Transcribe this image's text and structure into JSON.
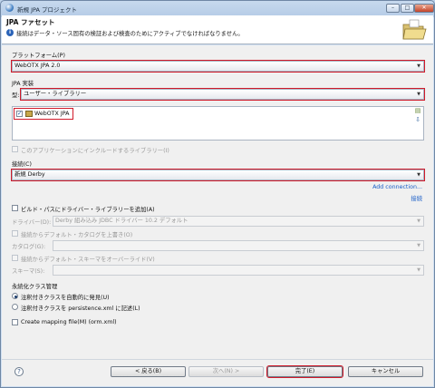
{
  "window": {
    "title": "新規 JPA プロジェクト",
    "controls": {
      "minimize": "–",
      "maximize": "□",
      "close": "✕"
    }
  },
  "header": {
    "title": "JPA ファセット",
    "message": "接続はデータ・ソース固有の検証および検査のためにアクティブでなければなりません。",
    "message_icon": "i"
  },
  "platform": {
    "label": "プラットフォーム(P)",
    "value": "WebOTX JPA 2.0"
  },
  "jpa_impl": {
    "group_label": "JPA 実装",
    "type_label": "型:",
    "type_value": "ユーザー・ライブラリー",
    "libraries": [
      {
        "label": "WebOTX JPA",
        "checked": true
      }
    ],
    "include_label": "このアプリケーションにインクルードするライブラリー(I)"
  },
  "connection": {
    "label": "接続(C)",
    "value": "新規 Derby",
    "add_link": "Add connection...",
    "connect_link": "接続"
  },
  "driver": {
    "add_to_build_path_label": "ビルド・パスにドライバー・ライブラリーを追加(A)",
    "driver_label": "ドライバー(D):",
    "driver_value": "Derby 組み込み JDBC ドライバー 10.2 デフォルト",
    "override_catalog_label": "接続からデフォルト・カタログを上書き(O)",
    "catalog_label": "カタログ(G):",
    "override_schema_label": "接続からデフォルト・スキーマをオーバーライド(V)",
    "schema_label": "スキーマ(S):"
  },
  "persistent_class": {
    "group_label": "永続化クラス管理",
    "options": [
      {
        "label": "注釈付きクラスを自動的に発見(U)",
        "selected": true
      },
      {
        "label": "注釈付きクラスを persistence.xml に記述(L)",
        "selected": false
      }
    ]
  },
  "mapping_file": {
    "label": "Create mapping file(M) (orm.xml)"
  },
  "buttons": {
    "help": "?",
    "back": "< 戻る(B)",
    "next": "次へ(N) >",
    "finish": "完了(E)",
    "cancel": "キャンセル"
  },
  "colors": {
    "highlight": "#d11a2a",
    "link": "#1a5ec7",
    "title_bar": "#bfd3ea"
  }
}
